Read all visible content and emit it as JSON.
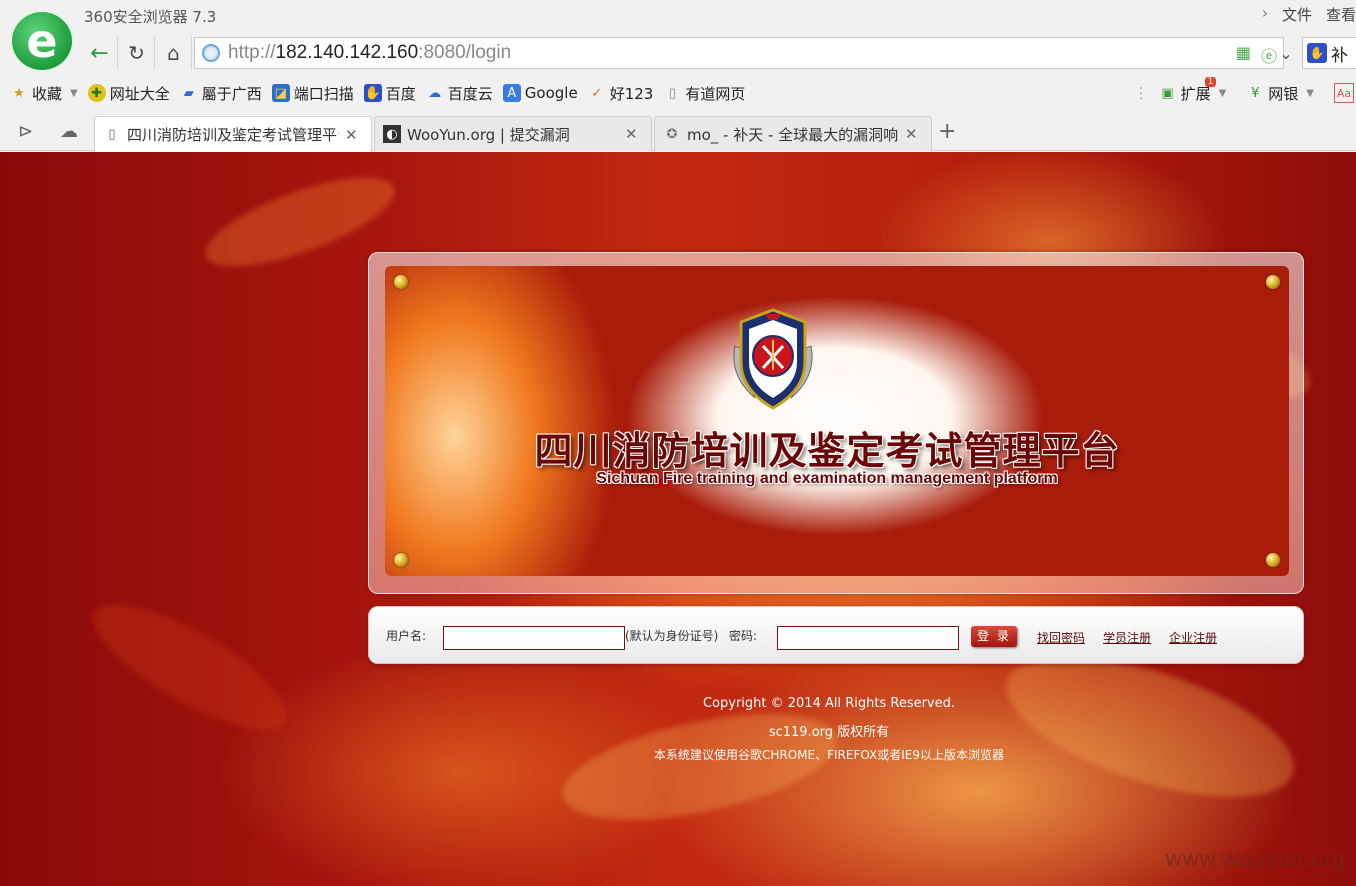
{
  "browser": {
    "app_title": "360安全浏览器 7.3",
    "menu": [
      "文件",
      "查看"
    ],
    "url_scheme": "http://",
    "url_host": "182.140.142.160",
    "url_rest": ":8080/login",
    "search_text": "补",
    "bookmarks": [
      {
        "label": "收藏",
        "icon": "star-icon"
      },
      {
        "label": "网址大全",
        "icon": "url-nav-icon"
      },
      {
        "label": "屬于广西",
        "icon": "bookmark-icon"
      },
      {
        "label": "端口扫描",
        "icon": "scan-icon"
      },
      {
        "label": "百度",
        "icon": "baidu-paw-icon"
      },
      {
        "label": "百度云",
        "icon": "cloud-icon"
      },
      {
        "label": "Google",
        "icon": "translate-icon"
      },
      {
        "label": "好123",
        "icon": "hao123-icon"
      },
      {
        "label": "有道网页",
        "icon": "page-icon"
      }
    ],
    "ext_label": "扩展",
    "ext_badge": "1",
    "bank_label": "网银",
    "tabs": [
      {
        "label": "四川消防培训及鉴定考试管理平台",
        "active": true
      },
      {
        "label": "WooYun.org | 提交漏洞",
        "active": false
      },
      {
        "label": "mo_ - 补天 - 全球最大的漏洞响应平台",
        "active": false
      }
    ]
  },
  "page": {
    "banner_title": "四川消防培训及鉴定考试管理平台",
    "banner_subtitle": "Sichuan Fire training and examination management platform",
    "login": {
      "username_label": "用户名:",
      "username_value": "",
      "username_hint": "(默认为身份证号)",
      "password_label": "密码:",
      "password_value": "",
      "login_button": "登 录",
      "forgot_link": "找回密码",
      "student_register_link": "学员注册",
      "company_register_link": "企业注册"
    },
    "footer": {
      "copyright": "Copyright © 2014 All Rights Reserved.",
      "owner": "sc119.org 版权所有",
      "browser_note": "本系统建议使用谷歌CHROME、FIREFOX或者IE9以上版本浏览器"
    },
    "watermark": "www.wooyun.org"
  },
  "colors": {
    "accent_green": "#1c9d3c",
    "page_red": "#a4140d",
    "title_red": "#6a0606"
  }
}
